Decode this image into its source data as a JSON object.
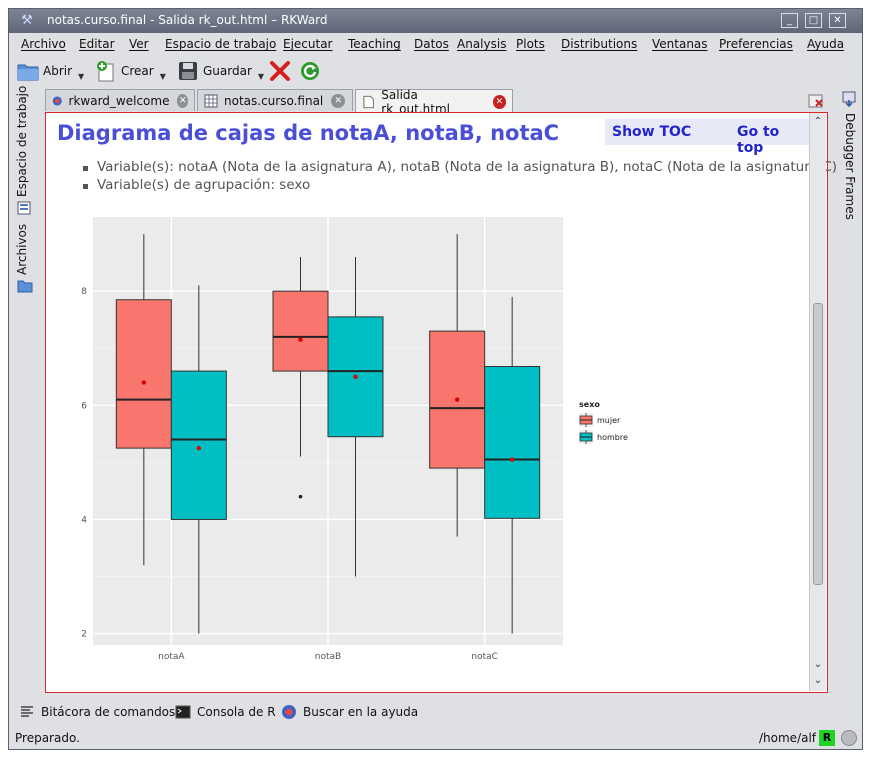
{
  "window": {
    "title": "notas.curso.final - Salida rk_out.html – RKWard"
  },
  "menu": [
    "Archivo",
    "Editar",
    "Ver",
    "Espacio de trabajo",
    "Ejecutar",
    "Teaching",
    "Datos",
    "Analysis",
    "Plots",
    "Distributions",
    "Ventanas",
    "Preferencias",
    "Ayuda"
  ],
  "toolbar": {
    "open_label": "Abrir",
    "new_label": "Crear",
    "save_label": "Guardar"
  },
  "left_dock": {
    "workspace_label": "Espacio de trabajo",
    "files_label": "Archivos"
  },
  "right_dock": {
    "debugger_label": "Debugger Frames"
  },
  "tabs": [
    {
      "label": "rkward_welcome",
      "active": false
    },
    {
      "label": "notas.curso.final",
      "active": false
    },
    {
      "label": "Salida rk_out.html",
      "active": true
    }
  ],
  "output": {
    "heading": "Diagrama de cajas de notaA, notaB, notaC",
    "show_toc": "Show TOC",
    "go_to_top": "Go to top",
    "variables_line": "Variable(s): notaA (Nota de la asignatura A), notaB (Nota de la asignatura B), notaC (Nota de la asignatura C)",
    "grouping_line": "Variable(s) de agrupación: sexo"
  },
  "chart_data": {
    "type": "boxplot",
    "categories": [
      "notaA",
      "notaB",
      "notaC"
    ],
    "ylim": [
      1.8,
      9.3
    ],
    "yticks": [
      2,
      4,
      6,
      8
    ],
    "grid": true,
    "legend": {
      "title": "sexo",
      "position": "right"
    },
    "series": [
      {
        "name": "mujer",
        "color": "#f8766d",
        "boxes": [
          {
            "min": 3.2,
            "q1": 5.25,
            "median": 6.1,
            "q3": 7.85,
            "max": 9.0,
            "mean": 6.4,
            "outliers": []
          },
          {
            "min": 5.1,
            "q1": 6.6,
            "median": 7.2,
            "q3": 8.0,
            "max": 8.6,
            "mean": 7.15,
            "outliers": [
              4.4
            ]
          },
          {
            "min": 3.7,
            "q1": 4.9,
            "median": 5.95,
            "q3": 7.3,
            "max": 9.0,
            "mean": 6.1,
            "outliers": []
          }
        ]
      },
      {
        "name": "hombre",
        "color": "#00bfc4",
        "boxes": [
          {
            "min": 2.0,
            "q1": 4.0,
            "median": 5.4,
            "q3": 6.6,
            "max": 8.1,
            "mean": 5.25,
            "outliers": []
          },
          {
            "min": 3.0,
            "q1": 5.45,
            "median": 6.6,
            "q3": 7.55,
            "max": 8.6,
            "mean": 6.5,
            "outliers": []
          },
          {
            "min": 2.0,
            "q1": 4.02,
            "median": 5.05,
            "q3": 6.68,
            "max": 7.9,
            "mean": 5.05,
            "outliers": []
          }
        ]
      }
    ]
  },
  "bottom_tabs": [
    "Bitácora de comandos",
    "Consola de R",
    "Buscar en la ayuda"
  ],
  "status": {
    "text": "Preparado.",
    "path": "/home/alf",
    "r_badge": "R"
  }
}
